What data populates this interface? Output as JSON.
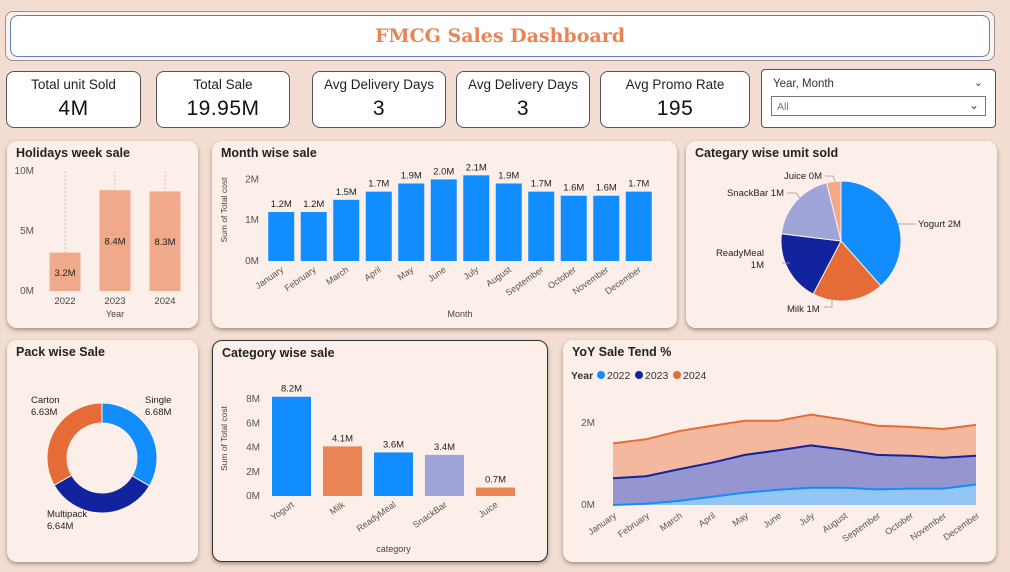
{
  "header": {
    "title": "FMCG Sales Dashboard"
  },
  "kpis": [
    {
      "label": "Total unit Sold",
      "value": "4M"
    },
    {
      "label": "Total Sale",
      "value": "19.95M"
    },
    {
      "label": "Avg Delivery Days",
      "value": "3"
    },
    {
      "label": "Avg Delivery Days",
      "value": "3"
    },
    {
      "label": "Avg Promo Rate",
      "value": "195"
    }
  ],
  "slicer": {
    "label": "Year, Month",
    "selected": "All",
    "icon": "chevron-down-icon"
  },
  "colors": {
    "accent": "#ea8455",
    "blue": "#118dff",
    "navy": "#12239e",
    "orange": "#e66c37",
    "lavender": "#a0a5d9",
    "salmon": "#f0a98a"
  },
  "chart_data": [
    {
      "id": "holidays",
      "type": "bar",
      "title": "Holidays week sale",
      "xlabel": "Year",
      "ylabel": "",
      "categories": [
        "2022",
        "2023",
        "2024"
      ],
      "values": [
        3.2,
        8.4,
        8.3
      ],
      "labels": [
        "3.2M",
        "8.4M",
        "8.3M"
      ],
      "yticks": [
        "0M",
        "5M",
        "10M"
      ],
      "ylim": [
        0,
        10
      ]
    },
    {
      "id": "month",
      "type": "bar",
      "title": "Month wise sale",
      "xlabel": "Month",
      "ylabel": "Sum of Total cost",
      "categories": [
        "January",
        "February",
        "March",
        "April",
        "May",
        "June",
        "July",
        "August",
        "September",
        "October",
        "November",
        "December"
      ],
      "values": [
        1.2,
        1.2,
        1.5,
        1.7,
        1.9,
        2.0,
        2.1,
        1.9,
        1.7,
        1.6,
        1.6,
        1.7
      ],
      "labels": [
        "1.2M",
        "1.2M",
        "1.5M",
        "1.7M",
        "1.9M",
        "2.0M",
        "2.1M",
        "1.9M",
        "1.7M",
        "1.6M",
        "1.6M",
        "1.7M"
      ],
      "yticks": [
        "0M",
        "1M",
        "2M"
      ],
      "ylim": [
        0,
        2.5
      ]
    },
    {
      "id": "catunits",
      "type": "pie",
      "title": "Categary wise umit sold",
      "slices": [
        {
          "name": "Yogurt",
          "value": 2.0,
          "label": "Yogurt 2M"
        },
        {
          "name": "Milk",
          "value": 1.0,
          "label": "Milk 1M"
        },
        {
          "name": "ReadyMeal",
          "value": 1.0,
          "label": "ReadyMeal 1M"
        },
        {
          "name": "SnackBar",
          "value": 1.0,
          "label": "SnackBar 1M"
        },
        {
          "name": "Juice",
          "value": 0.2,
          "label": "Juice 0M"
        }
      ]
    },
    {
      "id": "pack",
      "type": "pie",
      "title": "Pack wise Sale",
      "slices": [
        {
          "name": "Single",
          "value": 6.68,
          "label": "Single 6.68M"
        },
        {
          "name": "Multipack",
          "value": 6.64,
          "label": "Multipack 6.64M"
        },
        {
          "name": "Carton",
          "value": 6.63,
          "label": "Carton 6.63M"
        }
      ]
    },
    {
      "id": "category",
      "type": "bar",
      "title": "Category wise sale",
      "xlabel": "category",
      "ylabel": "Sum of Total cost",
      "categories": [
        "Yogurt",
        "Milk",
        "ReadyMeal",
        "SnackBar",
        "Juice"
      ],
      "values": [
        8.2,
        4.1,
        3.6,
        3.4,
        0.7
      ],
      "labels": [
        "8.2M",
        "4.1M",
        "3.6M",
        "3.4M",
        "0.7M"
      ],
      "yticks": [
        "0M",
        "2M",
        "4M",
        "6M",
        "8M"
      ],
      "ylim": [
        0,
        9.5
      ]
    },
    {
      "id": "yoy",
      "type": "area",
      "title": "YoY Sale Tend %",
      "legend_title": "Year",
      "categories": [
        "January",
        "February",
        "March",
        "April",
        "May",
        "June",
        "July",
        "August",
        "September",
        "October",
        "November",
        "December"
      ],
      "series": [
        {
          "name": "2022",
          "values": [
            0.0,
            0.03,
            0.1,
            0.2,
            0.3,
            0.37,
            0.42,
            0.42,
            0.38,
            0.4,
            0.4,
            0.5
          ]
        },
        {
          "name": "2023",
          "values": [
            0.65,
            0.7,
            0.87,
            1.03,
            1.22,
            1.33,
            1.45,
            1.35,
            1.22,
            1.2,
            1.15,
            1.2
          ]
        },
        {
          "name": "2024",
          "values": [
            1.5,
            1.6,
            1.8,
            1.93,
            2.05,
            2.05,
            2.2,
            2.08,
            1.93,
            1.9,
            1.85,
            1.95
          ]
        }
      ],
      "yticks": [
        "0M",
        "2M"
      ],
      "ylim": [
        0,
        2.8
      ]
    }
  ]
}
